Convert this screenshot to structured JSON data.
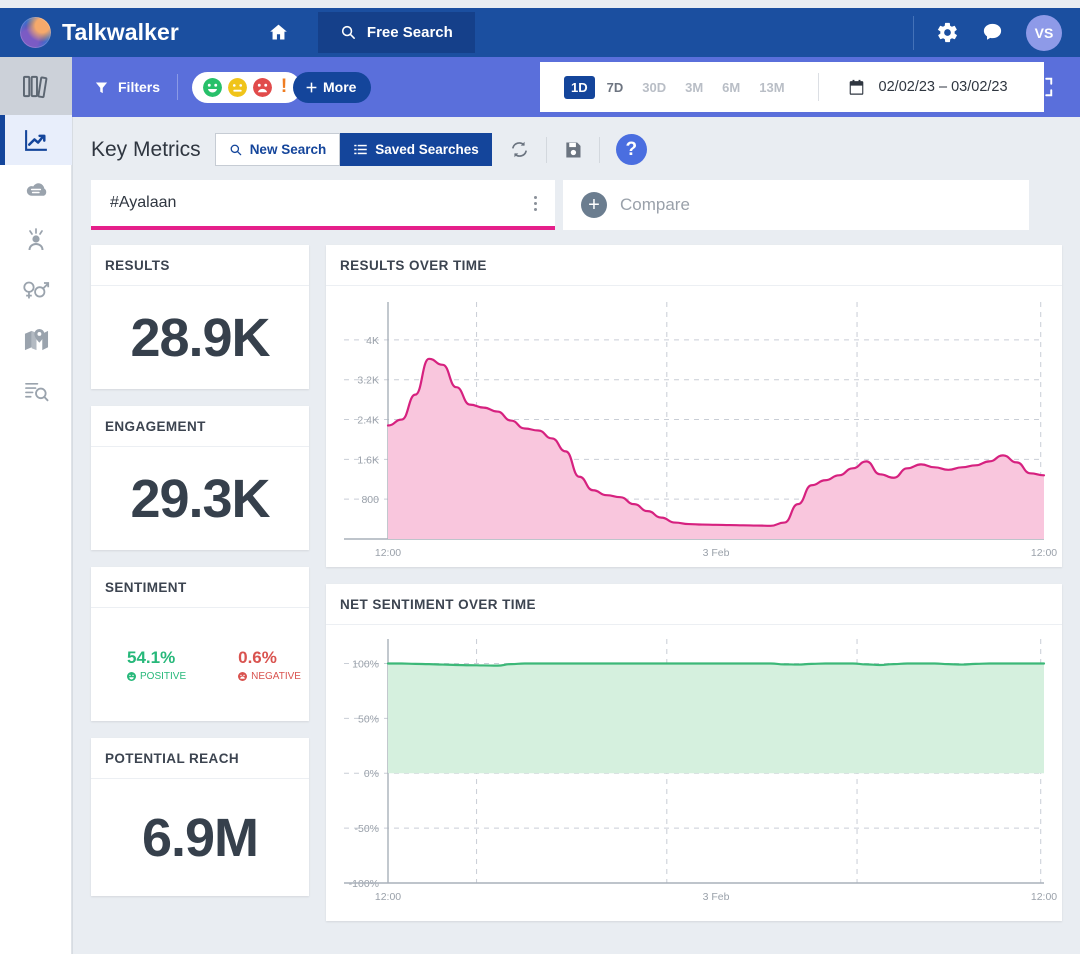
{
  "header": {
    "brand": "Talkwalker",
    "logo_icon": "talkwalker-logo-icon",
    "home_icon": "home-icon",
    "free_search_label": "Free Search",
    "free_search_icon": "search-icon",
    "settings_icon": "gear-icon",
    "chat_icon": "chat-icon",
    "avatar_initials": "VS"
  },
  "sidebar": {
    "items": [
      {
        "name": "sidebar-item-projects",
        "icon": "books-icon"
      },
      {
        "name": "sidebar-item-analytics",
        "icon": "trending-chart-icon",
        "active": true
      },
      {
        "name": "sidebar-item-cloud",
        "icon": "word-cloud-icon"
      },
      {
        "name": "sidebar-item-influencers",
        "icon": "influencer-icon"
      },
      {
        "name": "sidebar-item-demographics",
        "icon": "gender-icon"
      },
      {
        "name": "sidebar-item-geography",
        "icon": "map-icon"
      },
      {
        "name": "sidebar-item-results",
        "icon": "results-search-icon"
      }
    ]
  },
  "filterbar": {
    "filters_label": "Filters",
    "filter_icon": "funnel-icon",
    "sentiments": [
      {
        "name": "positive",
        "icon": "smile-icon",
        "color": "#27c06a"
      },
      {
        "name": "neutral",
        "icon": "neutral-face-icon",
        "color": "#f0c419"
      },
      {
        "name": "negative",
        "icon": "frown-icon",
        "color": "#e14b4b"
      },
      {
        "name": "alert",
        "icon": "exclamation-icon",
        "color": "#ef7d22"
      }
    ],
    "more_label": "More",
    "clear_icon": "clear-backspace-icon",
    "fullscreen_icon": "fullscreen-icon"
  },
  "daterange": {
    "options": [
      {
        "label": "1D",
        "state": "active"
      },
      {
        "label": "7D",
        "state": "available"
      },
      {
        "label": "30D",
        "state": "disabled"
      },
      {
        "label": "3M",
        "state": "disabled"
      },
      {
        "label": "6M",
        "state": "disabled"
      },
      {
        "label": "13M",
        "state": "disabled"
      }
    ],
    "calendar_icon": "calendar-icon",
    "value": "02/02/23 – 03/02/23"
  },
  "keymetrics": {
    "title": "Key Metrics",
    "new_search_label": "New Search",
    "new_search_icon": "search-icon",
    "saved_searches_label": "Saved Searches",
    "saved_searches_icon": "list-icon",
    "refresh_icon": "refresh-icon",
    "save_icon": "floppy-save-icon",
    "help_label": "?",
    "help_icon": "help-icon"
  },
  "search": {
    "term": "#Ayalaan",
    "accent_color": "#e51f8a",
    "menu_icon": "kebab-menu-icon",
    "compare_placeholder": "Compare",
    "compare_icon": "plus-circle-icon"
  },
  "cards": {
    "results": {
      "title": "RESULTS",
      "value": "28.9K"
    },
    "engagement": {
      "title": "ENGAGEMENT",
      "value": "29.3K"
    },
    "sentiment": {
      "title": "SENTIMENT",
      "positive_value": "54.1%",
      "positive_label": "POSITIVE",
      "positive_icon": "smile-small-icon",
      "negative_value": "0.6%",
      "negative_label": "NEGATIVE",
      "negative_icon": "frown-small-icon",
      "positive_color": "#27b87a",
      "negative_color": "#d9534f"
    },
    "reach": {
      "title": "POTENTIAL REACH",
      "value": "6.9M"
    }
  },
  "chart_data": [
    {
      "id": "results-over-time",
      "type": "area",
      "title": "RESULTS OVER TIME",
      "xlabel": "",
      "ylabel": "",
      "ylim": [
        0,
        4400
      ],
      "yticks": [
        800,
        1600,
        2400,
        3200,
        4000
      ],
      "ytick_labels": [
        "800",
        "1.6K",
        "2.4K",
        "3.2K",
        "4K"
      ],
      "xticks": [
        "12:00",
        "3 Feb",
        "12:00"
      ],
      "grid": true,
      "line_color": "#d6217f",
      "fill_color": "#f9c6dd",
      "x": [
        0,
        1,
        2,
        3,
        4,
        5,
        6,
        7,
        8,
        9,
        10,
        11,
        12,
        13,
        14,
        15,
        16,
        17,
        18,
        19,
        20,
        21,
        22,
        23,
        24,
        25,
        26,
        27,
        28,
        29,
        30,
        31,
        32,
        33,
        34,
        35,
        36,
        37,
        38,
        39,
        40,
        41,
        42,
        43,
        44,
        45,
        46,
        47,
        48
      ],
      "values": [
        2280,
        2400,
        2900,
        3620,
        3500,
        3050,
        2700,
        2640,
        2560,
        2380,
        2220,
        2180,
        2020,
        1760,
        1250,
        980,
        880,
        840,
        700,
        560,
        430,
        330,
        300,
        290,
        285,
        280,
        275,
        270,
        265,
        330,
        700,
        1080,
        1180,
        1280,
        1420,
        1560,
        1300,
        1230,
        1420,
        1500,
        1440,
        1390,
        1440,
        1480,
        1560,
        1680,
        1540,
        1320,
        1280
      ]
    },
    {
      "id": "net-sentiment-over-time",
      "type": "area",
      "title": "NET SENTIMENT OVER TIME",
      "xlabel": "",
      "ylabel": "",
      "ylim": [
        -100,
        115
      ],
      "yticks": [
        100,
        50,
        0,
        -50,
        -100
      ],
      "ytick_labels": [
        "100%",
        "50%",
        "0%",
        "-50%",
        "-100%"
      ],
      "xticks": [
        "12:00",
        "3 Feb",
        "12:00"
      ],
      "grid": true,
      "line_color": "#3cb878",
      "fill_color": "#d5f0de",
      "x": [
        0,
        1,
        2,
        3,
        4,
        5,
        6,
        7,
        8,
        9,
        10,
        11,
        12,
        13,
        14,
        15,
        16,
        17,
        18,
        19,
        20,
        21,
        22,
        23,
        24,
        25,
        26,
        27,
        28,
        29,
        30,
        31,
        32,
        33,
        34,
        35,
        36,
        37,
        38,
        39,
        40,
        41,
        42,
        43,
        44,
        45,
        46,
        47,
        48
      ],
      "values": [
        100,
        100,
        99.6,
        99.4,
        99,
        98.6,
        98.4,
        98.2,
        98,
        99.4,
        100,
        100,
        100,
        100,
        100,
        100,
        100,
        100,
        100,
        100,
        100,
        100,
        100,
        100,
        100,
        100,
        100,
        100,
        100,
        99.2,
        99,
        99.6,
        100,
        100,
        100,
        99.2,
        98.6,
        99.4,
        100,
        100,
        100,
        99.4,
        99,
        99.6,
        100,
        100,
        100,
        100,
        100
      ]
    }
  ]
}
